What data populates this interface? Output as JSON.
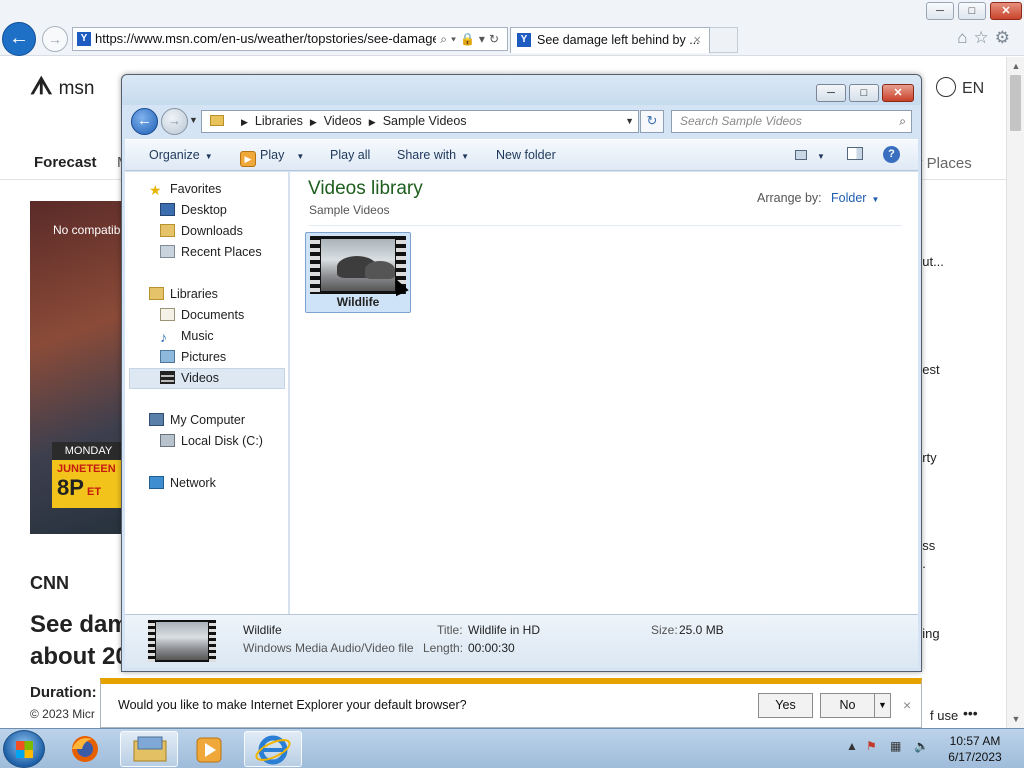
{
  "ie": {
    "url": "https://www.msn.com/en-us/weather/topstories/see-damage-l",
    "tab_title": "See damage left behind by ...",
    "back_glyph": "←",
    "forward_glyph": "→",
    "tab_close": "×"
  },
  "window_controls": {
    "minimize": "─",
    "maximize": "□",
    "close": "✕"
  },
  "page": {
    "logo": "msn",
    "language": "EN",
    "nav_forecast": "Forecast",
    "nav_m": "M",
    "nav_places": "y Places",
    "video_no_compat": "No compatib",
    "video_monday": "MONDAY",
    "video_promo_title": "JUNETEEN",
    "video_promo_time": "8P",
    "video_promo_tz": "ET",
    "source": "CNN",
    "headline_1": "See dam",
    "headline_2": "about 20",
    "duration": "Duration: C",
    "copyright": "© 2023 Micr",
    "right_items": [
      "out...",
      "gest",
      "arty",
      "ess",
      "...",
      "eing"
    ],
    "terms": "f use",
    "more": "•••"
  },
  "explorer": {
    "breadcrumb": [
      "Libraries",
      "Videos",
      "Sample Videos"
    ],
    "search_placeholder": "Search Sample Videos",
    "toolbar": {
      "organize": "Organize",
      "play": "Play",
      "play_all": "Play all",
      "share_with": "Share with",
      "new_folder": "New folder"
    },
    "nav": {
      "favorites": "Favorites",
      "desktop": "Desktop",
      "downloads": "Downloads",
      "recent_places": "Recent Places",
      "libraries": "Libraries",
      "documents": "Documents",
      "music": "Music",
      "pictures": "Pictures",
      "videos": "Videos",
      "my_computer": "My Computer",
      "local_disk": "Local Disk (C:)",
      "network": "Network"
    },
    "library_title": "Videos library",
    "library_subtitle": "Sample Videos",
    "arrange_label": "Arrange by:",
    "arrange_value": "Folder",
    "file_name": "Wildlife",
    "details": {
      "name": "Wildlife",
      "type": "Windows Media Audio/Video file",
      "title_label": "Title:",
      "title_value": "Wildlife in HD",
      "length_label": "Length:",
      "length_value": "00:00:30",
      "size_label": "Size:",
      "size_value": "25.0 MB"
    }
  },
  "notification": {
    "text": "Would you like to make Internet Explorer your default browser?",
    "yes": "Yes",
    "no": "No",
    "close": "×"
  },
  "taskbar": {
    "time": "10:57 AM",
    "date": "6/17/2023"
  }
}
